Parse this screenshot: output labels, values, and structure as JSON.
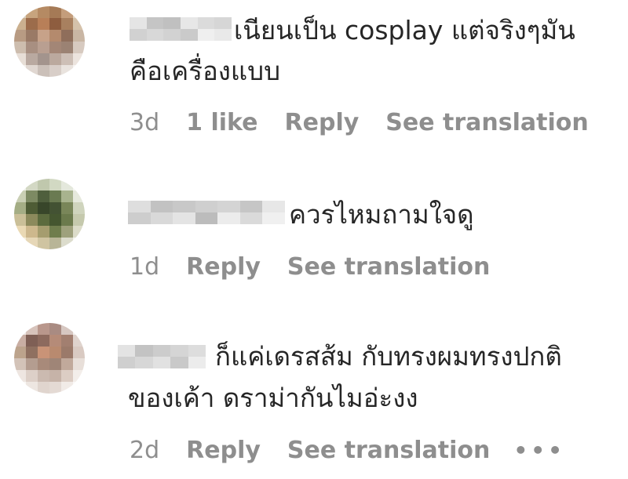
{
  "comments": [
    {
      "text_line1": "เนียนเป็น cosplay แต่จริงๆมัน",
      "text_line2": "คือเครื่องแบบ",
      "age": "3d",
      "likes": "1 like",
      "reply_label": "Reply",
      "translate_label": "See translation",
      "avatar_colors": [
        "#d9cfc0",
        "#c7a47e",
        "#b58a63",
        "#a57a56",
        "#c49d7b",
        "#e2d6c6",
        "#cbb08f",
        "#9c6c4b",
        "#b87f58",
        "#8e5d3f",
        "#a8805f",
        "#d5c2aa",
        "#b89b83",
        "#9a7a66",
        "#c7a289",
        "#b48a6d",
        "#8f6e5b",
        "#c9b6a4",
        "#cdbdae",
        "#a88f81",
        "#b99f91",
        "#a38676",
        "#9b8273",
        "#d7cac0",
        "#e7ded6",
        "#b9a9a0",
        "#a3948d",
        "#bba99e",
        "#cdbfb6",
        "#ece4de",
        "#f4efeb",
        "#e0d7d1",
        "#cbc0b9",
        "#d8cec8",
        "#e9e3de",
        "#f7f4f2"
      ],
      "username_colors": [
        "#e4e4e4",
        "#cfcfcf",
        "#c2c2c2",
        "#d6d6d6",
        "#bdbdbd",
        "#d0d0d0",
        "#e6e6e6",
        "#c8c8c8",
        "#dadada",
        "#efefef",
        "#d4d4d4",
        "#e8e8e8"
      ]
    },
    {
      "text_line1": "ควรไหมถามใจดู",
      "age": "1d",
      "reply_label": "Reply",
      "translate_label": "See translation",
      "avatar_colors": [
        "#eef0e8",
        "#d3d8c4",
        "#c0c8ad",
        "#d2d9c3",
        "#e4e8dc",
        "#f5f6f1",
        "#c9cfb4",
        "#7d8a63",
        "#4f5f3d",
        "#6a7a51",
        "#a8b38e",
        "#e6e9dd",
        "#a4ad85",
        "#4e5c35",
        "#38462a",
        "#435233",
        "#798659",
        "#cfd4bd",
        "#cabf98",
        "#8c8a5c",
        "#5c6b3e",
        "#455630",
        "#6b7a4c",
        "#c5c9ad",
        "#ead9b4",
        "#cdb88d",
        "#a59d6f",
        "#6f7d4d",
        "#9ea17c",
        "#dcdcc9",
        "#f6eedd",
        "#e6d7b7",
        "#cfc4a1",
        "#b8b597",
        "#dcdccc",
        "#f5f5ee"
      ],
      "username_colors": [
        "#dddddd",
        "#cbcbcb",
        "#bfbfbf",
        "#d7d7d7",
        "#c6c6c6",
        "#e3e3e3",
        "#cdcdcd",
        "#b9b9b9",
        "#d2d2d2",
        "#ebebeb",
        "#c4c4c4",
        "#d9d9d9",
        "#e6e6e6",
        "#f0f0f0"
      ]
    },
    {
      "text_line1": "ก็แค่เดรสส้ม กับทรงผมทรงปกติ",
      "text_line2": "ของเค้า ดราม่ากันไมอ่ะงง",
      "age": "2d",
      "reply_label": "Reply",
      "translate_label": "See translation",
      "more_label": "•••",
      "avatar_colors": [
        "#efe9e6",
        "#d7c3bb",
        "#b9978c",
        "#a98b82",
        "#d6c7c1",
        "#f5f1ef",
        "#c9aea3",
        "#7f5f55",
        "#8d6a5e",
        "#b58b78",
        "#a27f70",
        "#dfd3cd",
        "#bca38c",
        "#8f7060",
        "#c99377",
        "#b98a6f",
        "#9b7a6a",
        "#d9cac2",
        "#d3c3b8",
        "#b49d90",
        "#a88a7a",
        "#9f8577",
        "#c1a99b",
        "#e8dfd9",
        "#eee6e1",
        "#ddd0c8",
        "#cbbab0",
        "#c6b3a8",
        "#dccdc4",
        "#f3eeea",
        "#faf8f6",
        "#ede6e1",
        "#e0d5ce",
        "#e4dad4",
        "#f1ebe7",
        "#fbf9f8"
      ],
      "username_colors": [
        "#e2e2e2",
        "#cdcdcd",
        "#c0c0c0",
        "#d5d5d5",
        "#cacaca",
        "#e0e0e0",
        "#d3d3d3",
        "#c7c7c7",
        "#dcdcdc",
        "#ececec"
      ]
    }
  ]
}
